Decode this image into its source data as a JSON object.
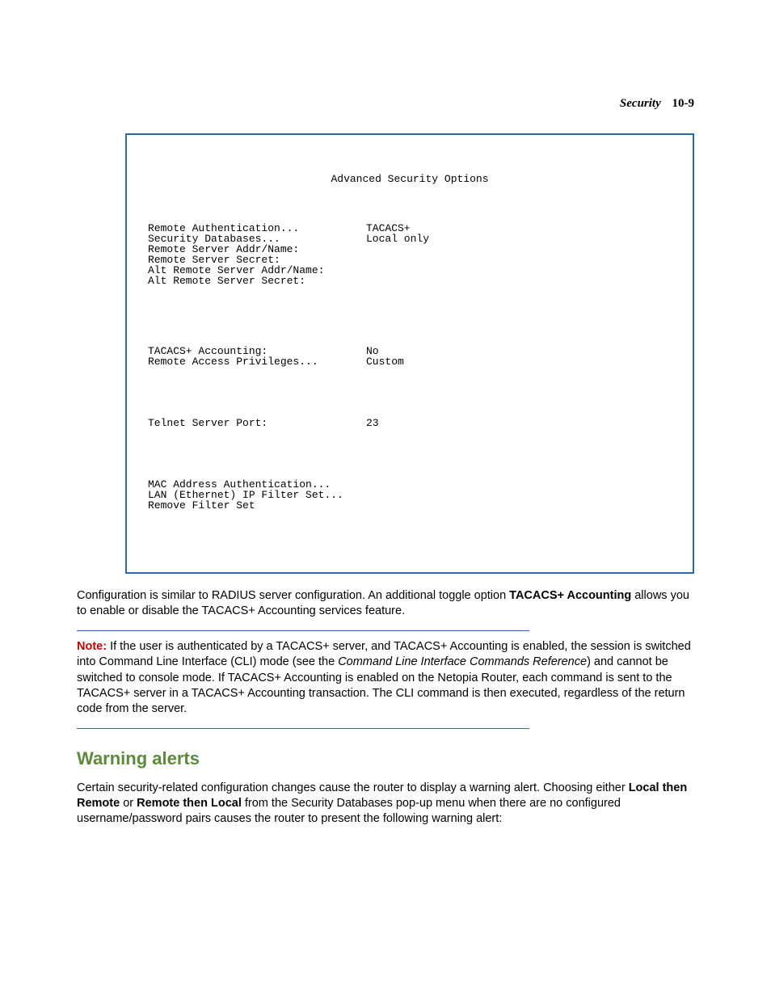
{
  "header": {
    "section": "Security",
    "page": "10-9"
  },
  "terminal": {
    "title": "Advanced Security Options",
    "rows1": [
      {
        "label": "Remote Authentication...",
        "value": "TACACS+"
      },
      {
        "label": "Security Databases...",
        "value": "Local only"
      },
      {
        "label": "Remote Server Addr/Name:",
        "value": ""
      },
      {
        "label": "Remote Server Secret:",
        "value": ""
      },
      {
        "label": "Alt Remote Server Addr/Name:",
        "value": ""
      },
      {
        "label": "Alt Remote Server Secret:",
        "value": ""
      }
    ],
    "rows2": [
      {
        "label": "TACACS+ Accounting:",
        "value": "No"
      },
      {
        "label": "Remote Access Privileges...",
        "value": "Custom"
      }
    ],
    "rows3": [
      {
        "label": "Telnet Server Port:",
        "value": "23"
      }
    ],
    "rows4": [
      {
        "label": "MAC Address Authentication...",
        "value": ""
      },
      {
        "label": "LAN (Ethernet) IP Filter Set...",
        "value": ""
      },
      {
        "label": "Remove Filter Set",
        "value": ""
      }
    ]
  },
  "para1_a": "Configuration is similar to RADIUS server configuration. An additional toggle option ",
  "para1_bold": "TACACS+ Accounting",
  "para1_b": " allows you to enable or disable the TACACS+ Accounting services feature.",
  "note": {
    "label": "Note:",
    "a": "  If the user is authenticated by a TACACS+ server, and TACACS+ Accounting is enabled, the session is switched into Command Line Interface (CLI) mode (see the ",
    "italic": "Command Line Interface Commands Reference",
    "b": ") and cannot be switched to console mode. If TACACS+ Accounting is enabled on the Netopia Router, each command is sent to the TACACS+ server in a TACACS+ Accounting transaction. The CLI command is then executed, regardless of the return code from the server."
  },
  "section_title": "Warning alerts",
  "para2_a": "Certain security-related configuration changes cause the router to display a warning alert. Choosing either ",
  "para2_bold1": "Local then Remote",
  "para2_mid": " or ",
  "para2_bold2": "Remote then Local",
  "para2_b": " from the Security Databases pop-up menu when there are no configured username/password pairs causes the router to present the following warning alert:"
}
